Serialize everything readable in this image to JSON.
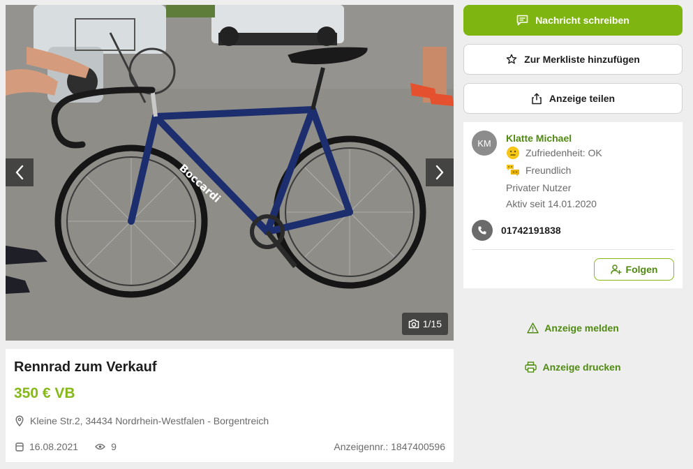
{
  "actions": {
    "message_label": "Nachricht schreiben",
    "watchlist_label": "Zur Merkliste hinzufügen",
    "share_label": "Anzeige teilen",
    "report_label": "Anzeige melden",
    "print_label": "Anzeige drucken"
  },
  "gallery": {
    "counter": "1/15",
    "current_image": 1,
    "total_images": 15,
    "frame_brand_text": "Boccardi"
  },
  "listing": {
    "title": "Rennrad zum Verkauf",
    "price": "350 € VB",
    "location": "Kleine Str.2, 34434 Nordrhein-Westfalen - Borgentreich",
    "date": "16.08.2021",
    "views": "9",
    "ad_number": "Anzeigennr.: 1847400596"
  },
  "seller": {
    "initials": "KM",
    "name": "Klatte Michael",
    "satisfaction": "Zufriedenheit: OK",
    "friendliness": "Freundlich",
    "user_type": "Privater Nutzer",
    "active_since": "Aktiv seit 14.01.2020",
    "phone": "01742191838",
    "follow_label": "Folgen"
  },
  "colors": {
    "primary_green": "#7fb511",
    "price_green": "#86b817",
    "link_green": "#4f8a10"
  },
  "icons": {
    "message": "chat-icon",
    "watchlist": "star-icon",
    "share": "share-icon",
    "location": "location-pin-icon",
    "date": "calendar-icon",
    "views": "eye-icon",
    "phone": "phone-icon",
    "follow": "add-user-icon",
    "report": "warning-icon",
    "print": "printer-icon",
    "camera": "camera-icon"
  }
}
